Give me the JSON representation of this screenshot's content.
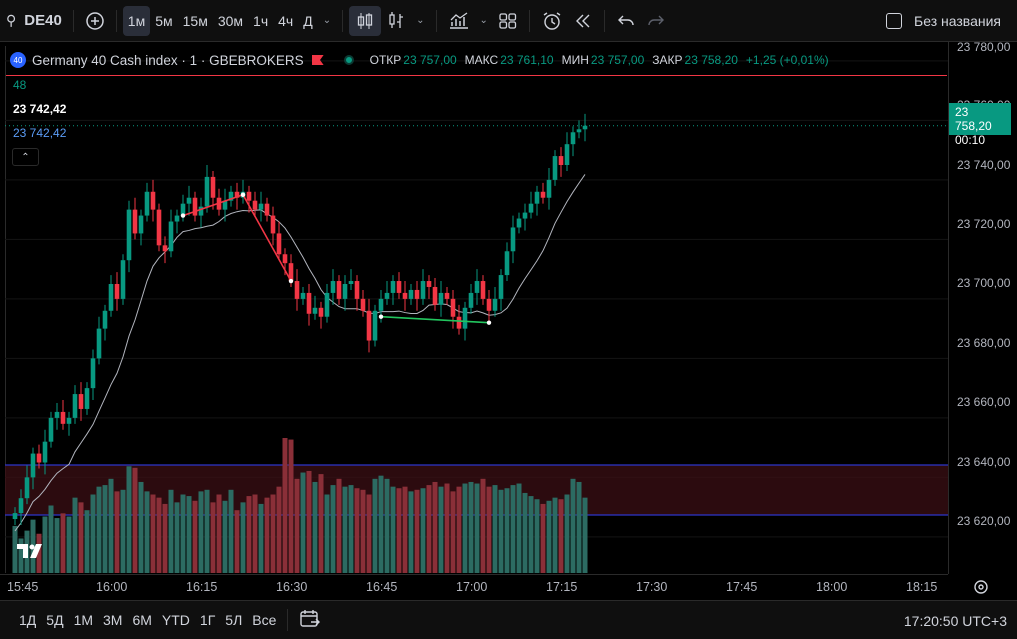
{
  "toolbar": {
    "symbol": "DE40",
    "intervals": [
      "1м",
      "5м",
      "15м",
      "30м",
      "1ч",
      "4ч",
      "Д"
    ],
    "active_interval": "1м",
    "layout_name": "Без названия"
  },
  "legend": {
    "badge": "40",
    "title": "Germany 40 Cash index · 1 · GBEBROKERS",
    "open_label": "ОТКР",
    "open": "23 757,00",
    "high_label": "МАКС",
    "high": "23 761,10",
    "low_label": "МИН",
    "low": "23 757,00",
    "close_label": "ЗАКР",
    "close": "23 758,20",
    "change": "+1,25 (+0,01%)"
  },
  "indicators": {
    "length": "48",
    "value_white": "23 742,42",
    "value_blue": "23 742,42"
  },
  "price_scale": {
    "labels": [
      "23 780,00",
      "23 760,00",
      "23 740,00",
      "23 720,00",
      "23 700,00",
      "23 680,00",
      "23 660,00",
      "23 640,00",
      "23 620,00"
    ],
    "current_price": "23 758,20",
    "countdown": "00:10"
  },
  "time_axis": {
    "labels": [
      "15:45",
      "16:00",
      "16:15",
      "16:30",
      "16:45",
      "17:00",
      "17:15",
      "17:30",
      "17:45",
      "18:00",
      "18:15"
    ]
  },
  "bottombar": {
    "ranges": [
      "1Д",
      "5Д",
      "1М",
      "3М",
      "6М",
      "YTD",
      "1Г",
      "5Л",
      "Все"
    ],
    "clock": "17:20:50 UTC+3"
  },
  "colors": {
    "up": "#089981",
    "down": "#f23645",
    "ma_line": "#b2b5be",
    "accent": "#2962ff"
  },
  "chart_data": {
    "type": "candlestick",
    "symbol": "Germany 40 Cash index",
    "interval": "1",
    "ylim": [
      23615,
      23785
    ],
    "x": [
      "15:45",
      "15:46",
      "15:47",
      "15:48",
      "15:49",
      "15:50",
      "15:51",
      "15:52",
      "15:53",
      "15:54",
      "15:55",
      "15:56",
      "15:57",
      "15:58",
      "15:59",
      "16:00",
      "16:01",
      "16:02",
      "16:03",
      "16:04",
      "16:05",
      "16:06",
      "16:07",
      "16:08",
      "16:09",
      "16:10",
      "16:11",
      "16:12",
      "16:13",
      "16:14",
      "16:15",
      "16:16",
      "16:17",
      "16:18",
      "16:19",
      "16:20",
      "16:21",
      "16:22",
      "16:23",
      "16:24",
      "16:25",
      "16:26",
      "16:27",
      "16:28",
      "16:29",
      "16:30",
      "16:31",
      "16:32",
      "16:33",
      "16:34",
      "16:35",
      "16:36",
      "16:37",
      "16:38",
      "16:39",
      "16:40",
      "16:41",
      "16:42",
      "16:43",
      "16:44",
      "16:45",
      "16:46",
      "16:47",
      "16:48",
      "16:49",
      "16:50",
      "16:51",
      "16:52",
      "16:53",
      "16:54",
      "16:55",
      "16:56",
      "16:57",
      "16:58",
      "16:59",
      "17:00",
      "17:01",
      "17:02",
      "17:03",
      "17:04",
      "17:05",
      "17:06",
      "17:07",
      "17:08",
      "17:09",
      "17:10",
      "17:11",
      "17:12",
      "17:13",
      "17:14",
      "17:15",
      "17:16",
      "17:17",
      "17:18",
      "17:19",
      "17:20"
    ],
    "close": [
      23628,
      23633,
      23640,
      23648,
      23645,
      23652,
      23660,
      23662,
      23658,
      23660,
      23668,
      23663,
      23670,
      23680,
      23690,
      23696,
      23705,
      23700,
      23713,
      23730,
      23722,
      23728,
      23736,
      23730,
      23718,
      23716,
      23726,
      23728,
      23732,
      23734,
      23728,
      23731,
      23741,
      23734,
      23730,
      23733,
      23736,
      23734,
      23736,
      23733,
      23730,
      23732,
      23728,
      23722,
      23715,
      23712,
      23706,
      23700,
      23702,
      23695,
      23697,
      23694,
      23702,
      23706,
      23700,
      23705,
      23706,
      23700,
      23696,
      23686,
      23696,
      23700,
      23702,
      23706,
      23702,
      23700,
      23703,
      23700,
      23706,
      23704,
      23698,
      23702,
      23700,
      23694,
      23690,
      23697,
      23702,
      23706,
      23700,
      23696,
      23700,
      23708,
      23716,
      23724,
      23727,
      23729,
      23732,
      23736,
      23734,
      23740,
      23748,
      23745,
      23752,
      23756,
      23757,
      23758.2
    ],
    "volume": [
      30,
      22,
      27,
      34,
      25,
      36,
      43,
      35,
      38,
      36,
      48,
      45,
      40,
      50,
      55,
      56,
      60,
      52,
      53,
      68,
      67,
      58,
      52,
      50,
      48,
      44,
      53,
      45,
      50,
      49,
      46,
      52,
      53,
      45,
      50,
      46,
      53,
      40,
      45,
      49,
      50,
      44,
      48,
      50,
      55,
      86,
      85,
      60,
      64,
      65,
      58,
      63,
      50,
      56,
      60,
      55,
      56,
      54,
      53,
      50,
      60,
      62,
      60,
      55,
      54,
      55,
      52,
      53,
      54,
      56,
      58,
      55,
      57,
      52,
      55,
      57,
      58,
      57,
      60,
      55,
      56,
      53,
      54,
      56,
      57,
      51,
      49,
      47,
      44,
      46,
      48,
      47,
      50,
      60,
      58,
      48
    ]
  }
}
